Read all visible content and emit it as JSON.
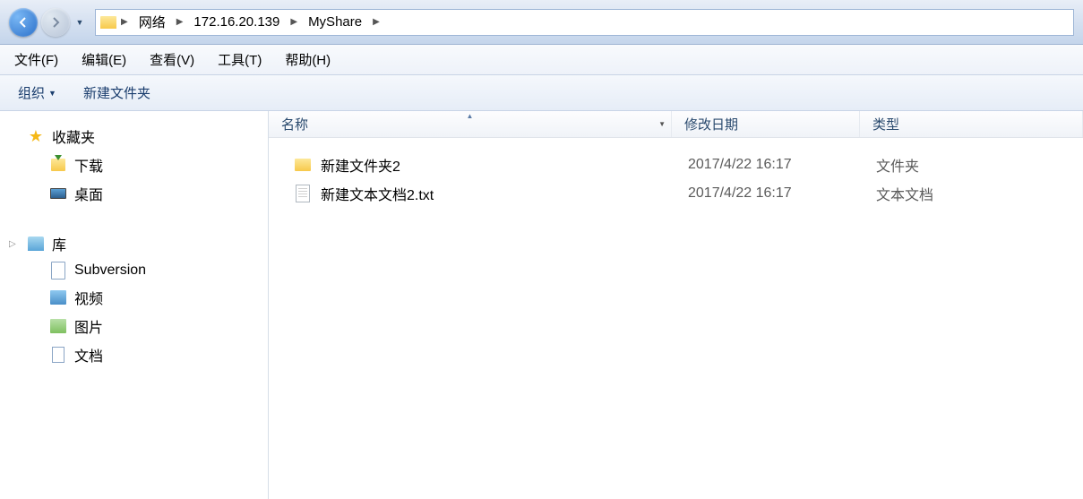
{
  "breadcrumb": {
    "items": [
      "网络",
      "172.16.20.139",
      "MyShare"
    ]
  },
  "menu": {
    "file": "文件(F)",
    "edit": "编辑(E)",
    "view": "查看(V)",
    "tools": "工具(T)",
    "help": "帮助(H)"
  },
  "toolbar": {
    "organize": "组织",
    "new_folder": "新建文件夹"
  },
  "sidebar": {
    "favorites": {
      "label": "收藏夹",
      "items": [
        "下载",
        "桌面"
      ]
    },
    "libraries": {
      "label": "库",
      "items": [
        "Subversion",
        "视频",
        "图片",
        "文档"
      ]
    }
  },
  "columns": {
    "name": "名称",
    "modified": "修改日期",
    "type": "类型"
  },
  "files": [
    {
      "name": "新建文件夹2",
      "modified": "2017/4/22 16:17",
      "type": "文件夹",
      "icon": "folder"
    },
    {
      "name": "新建文本文档2.txt",
      "modified": "2017/4/22 16:17",
      "type": "文本文档",
      "icon": "text"
    }
  ]
}
